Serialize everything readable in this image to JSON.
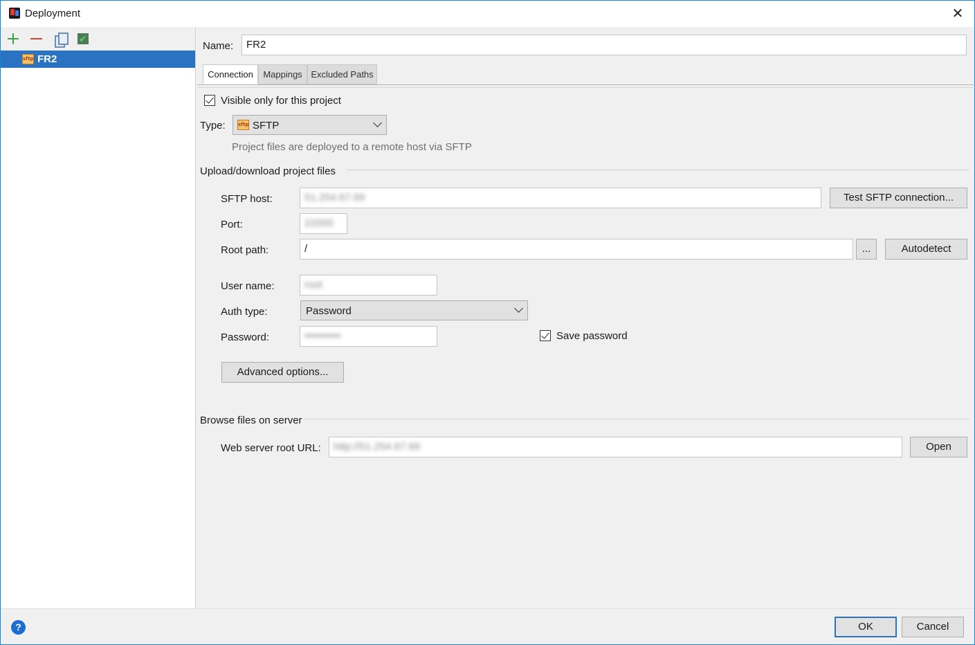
{
  "window": {
    "title": "Deployment",
    "close_glyph": "✕"
  },
  "sidebar": {
    "toolbar": {
      "add": "add-icon",
      "remove": "remove-icon",
      "copy": "copy-icon",
      "set_default": "set-default-icon"
    },
    "servers": [
      {
        "label": "FR2",
        "icon": "sftp-icon",
        "icon_text": "sftp",
        "selected": true
      }
    ]
  },
  "form": {
    "name_label": "Name:",
    "name_value": "FR2",
    "tabs": [
      {
        "label": "Connection",
        "active": true
      },
      {
        "label": "Mappings",
        "active": false
      },
      {
        "label": "Excluded Paths",
        "active": false
      }
    ],
    "visible_only_label": "Visible only for this project",
    "visible_only_checked": true,
    "type_label": "Type:",
    "type_value": "SFTP",
    "type_icon_text": "sftp",
    "type_description": "Project files are deployed to a remote host via SFTP",
    "upload_section_title": "Upload/download project files",
    "sftp_host_label": "SFTP host:",
    "sftp_host_value": "51.254.67.69",
    "test_connection_label": "Test SFTP connection...",
    "port_label": "Port:",
    "port_value": "22000",
    "root_path_label": "Root path:",
    "root_path_value": "/",
    "browse_label": "...",
    "autodetect_label": "Autodetect",
    "user_name_label": "User name:",
    "user_name_value": "root",
    "auth_type_label": "Auth type:",
    "auth_type_value": "Password",
    "password_label": "Password:",
    "password_value": "••••••••••",
    "save_password_label": "Save password",
    "save_password_checked": true,
    "advanced_options_label": "Advanced options...",
    "browse_section_title": "Browse files on server",
    "web_root_label": "Web server root URL:",
    "web_root_value": "http://51.254.67.69",
    "open_label": "Open"
  },
  "footer": {
    "help_glyph": "?",
    "ok_label": "OK",
    "cancel_label": "Cancel"
  },
  "colors": {
    "selection": "#2a72c2",
    "window_border": "#1883d7",
    "add_green": "#3aa346",
    "remove_red": "#d9403a",
    "help_blue": "#1c6dd0"
  }
}
